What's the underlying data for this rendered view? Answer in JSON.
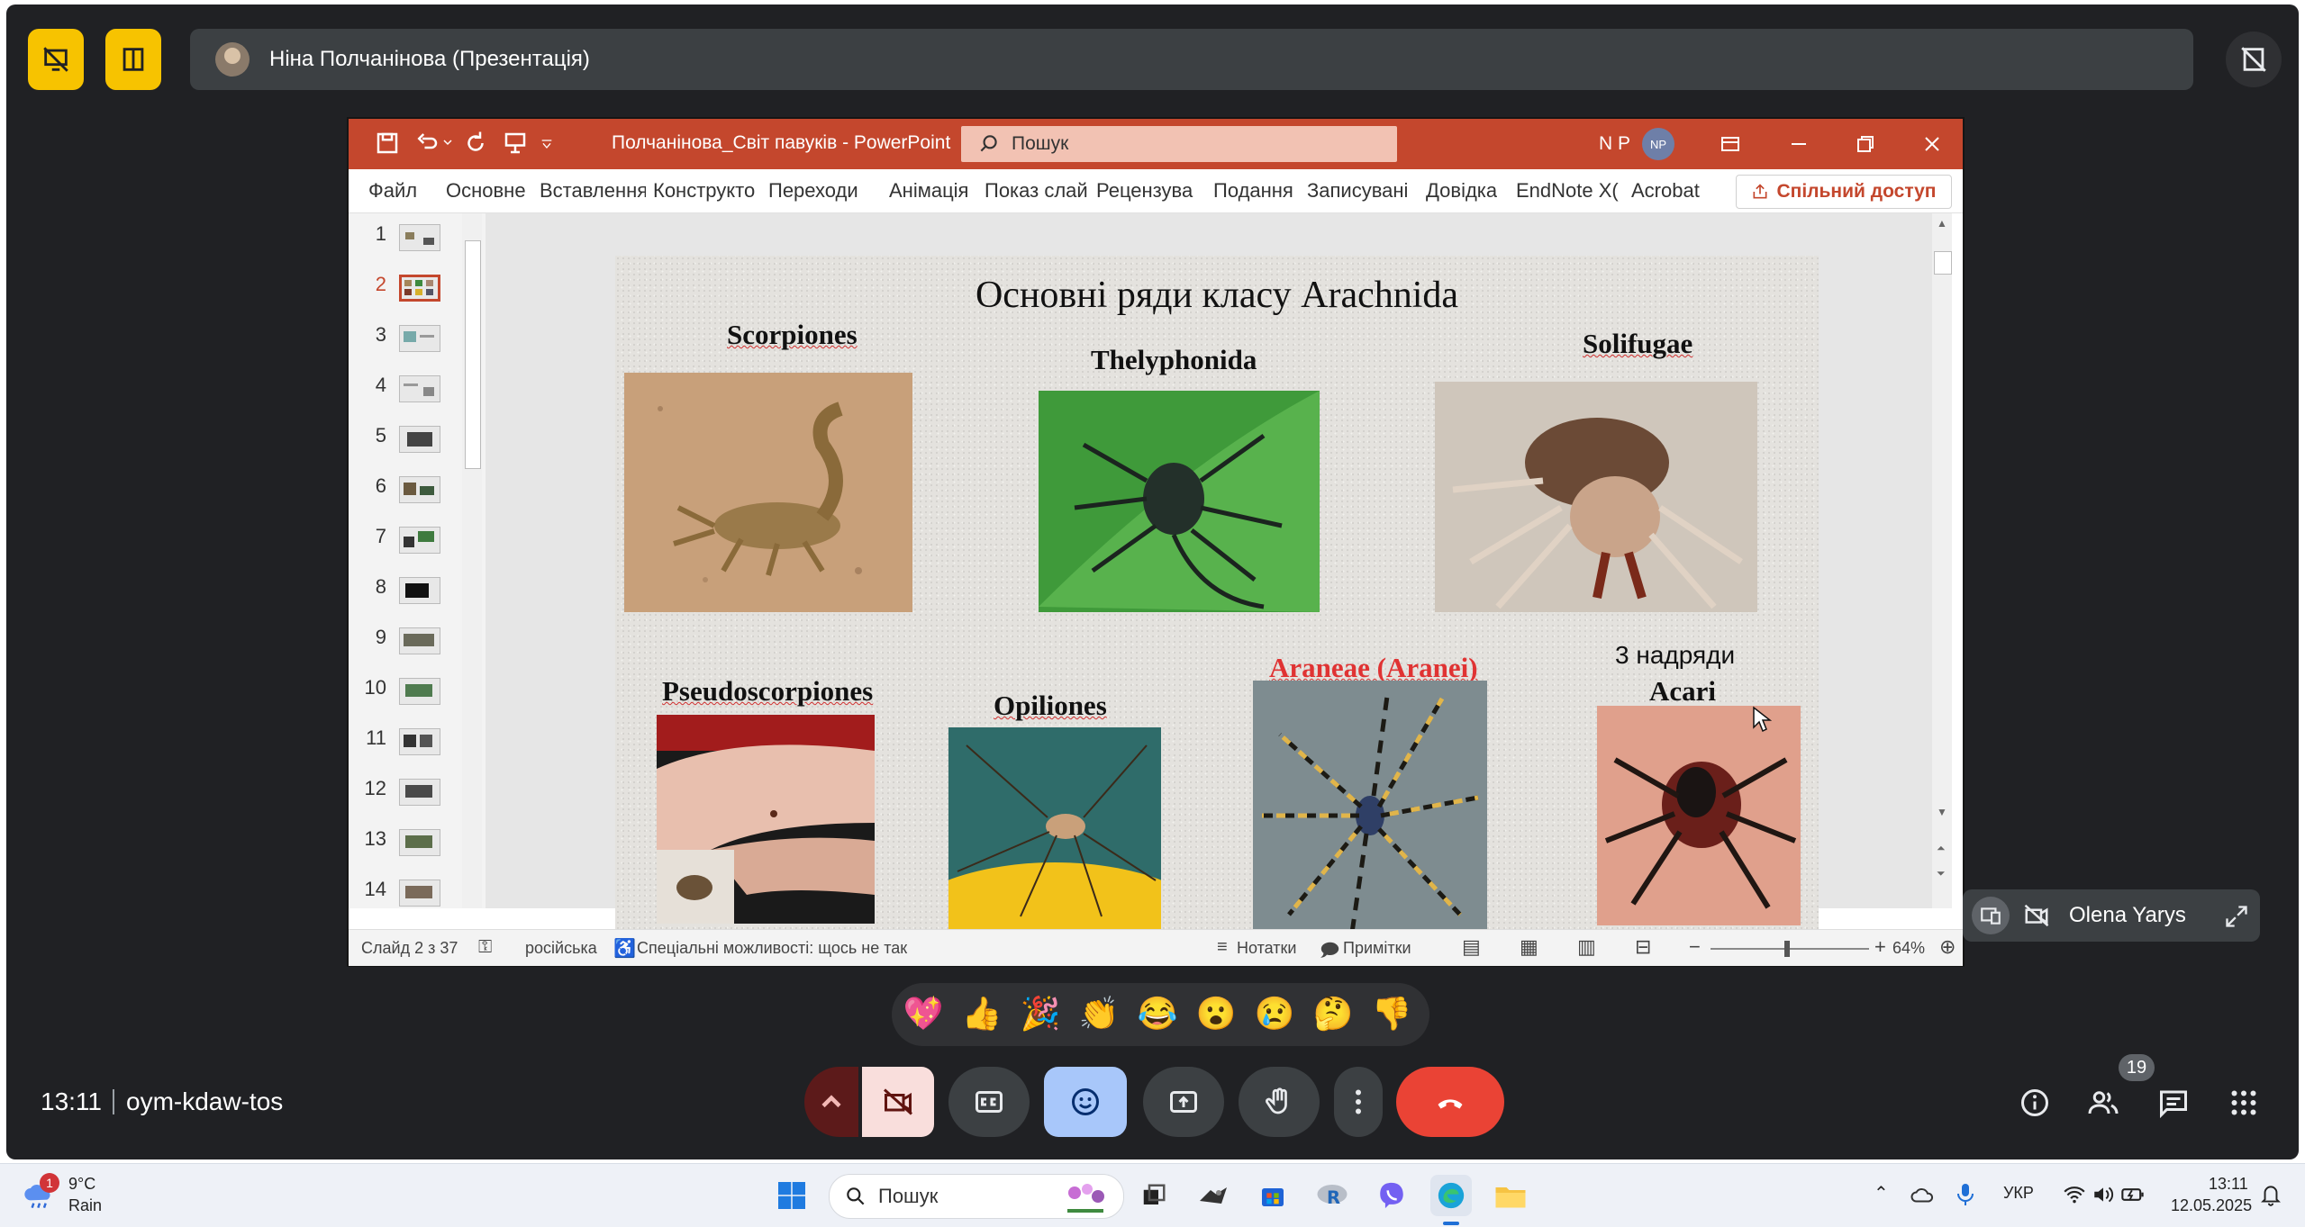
{
  "meet": {
    "presenter_name": "Ніна Полчанінова (Презентація)",
    "time": "13:11",
    "meeting_code": "oym-kdaw-tos",
    "participants_count": "19",
    "tile_name": "Olena Yarys",
    "reactions": [
      "💖",
      "👍",
      "🎉",
      "👏",
      "😂",
      "😮",
      "😢",
      "🤔",
      "👎"
    ]
  },
  "ppt": {
    "filename": "Полчанінова_Світ павуків  -  PowerPoint",
    "search_placeholder": "Пошук",
    "user_initials": "N P",
    "avatar_initials": "NP",
    "tabs": [
      "Файл",
      "Основне",
      "Вставлення",
      "Конструкто",
      "Переходи",
      "Анімація",
      "Показ слай",
      "Рецензува",
      "Подання",
      "Записувані",
      "Довідка",
      "EndNote X(",
      "Acrobat"
    ],
    "share_label": "Спільний доступ",
    "slide_numbers": [
      "1",
      "2",
      "3",
      "4",
      "5",
      "6",
      "7",
      "8",
      "9",
      "10",
      "11",
      "12",
      "13",
      "14"
    ],
    "status": {
      "slide_info": "Слайд 2 з 37",
      "language": "російська",
      "accessibility": "Спеціальні можливості: щось не так",
      "notes": "Нотатки",
      "comments": "Примітки",
      "zoom": "64%"
    }
  },
  "slide": {
    "title": "Основні ряди класу Arachnida",
    "labels": {
      "scorpiones": "Scorpiones",
      "thelyphonida": "Thelyphonida",
      "solifugae": "Solifugae",
      "pseudoscorpiones": "Pseudoscorpiones",
      "opiliones": "Opiliones",
      "araneae": "Araneae (Aranei)",
      "nadryady": "3 надряди",
      "acari": "Acari"
    }
  },
  "taskbar": {
    "weather_temp": "9°C",
    "weather_desc": "Rain",
    "weather_badge": "1",
    "search_label": "Пошук",
    "lang": "УКР",
    "time": "13:11",
    "date": "12.05.2025"
  },
  "colors": {
    "meet_bg": "#202124",
    "ppt_accent": "#c4472d",
    "leave_red": "#ea4335",
    "reaction_active": "#a8c7fa"
  }
}
